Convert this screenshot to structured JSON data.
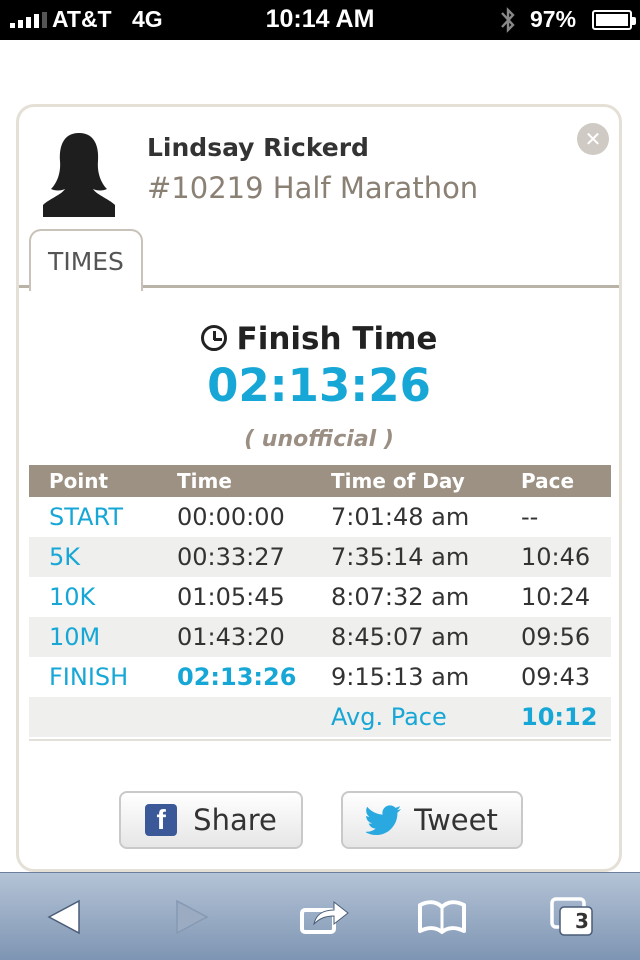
{
  "status_bar": {
    "carrier": "AT&T",
    "network": "4G",
    "time": "10:14 AM",
    "battery": "97%"
  },
  "runner": {
    "name": "Lindsay Rickerd",
    "race": "#10219 Half Marathon"
  },
  "tabs": [
    {
      "label": "TIMES"
    }
  ],
  "finish": {
    "label": "Finish Time",
    "time": "02:13:26",
    "note": "( unofficial )"
  },
  "table": {
    "headers": [
      "Point",
      "Time",
      "Time of Day",
      "Pace"
    ],
    "rows": [
      {
        "point": "START",
        "time": "00:00:00",
        "tod": "7:01:48 am",
        "pace": "--"
      },
      {
        "point": "5K",
        "time": "00:33:27",
        "tod": "7:35:14 am",
        "pace": "10:46"
      },
      {
        "point": "10K",
        "time": "01:05:45",
        "tod": "8:07:32 am",
        "pace": "10:24"
      },
      {
        "point": "10M",
        "time": "01:43:20",
        "tod": "8:45:07 am",
        "pace": "09:56"
      },
      {
        "point": "FINISH",
        "time": "02:13:26",
        "tod": "9:15:13 am",
        "pace": "09:43"
      }
    ],
    "avg_label": "Avg. Pace",
    "avg_value": "10:12"
  },
  "actions": {
    "share": "Share",
    "tweet": "Tweet"
  },
  "toolbar": {
    "tabs_count": "3"
  },
  "colors": {
    "accent": "#17a7d6",
    "header_bg": "#9c9183",
    "facebook": "#3b5998",
    "twitter": "#2aa9e0"
  }
}
